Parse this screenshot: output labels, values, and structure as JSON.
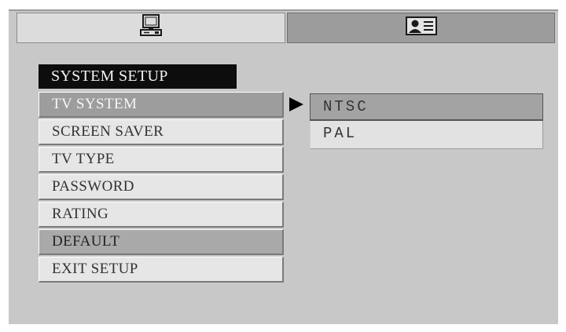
{
  "tabs": [
    {
      "icon": "monitor-icon",
      "active": true
    },
    {
      "icon": "user-profile-icon",
      "active": false
    }
  ],
  "menu": {
    "title": "SYSTEM SETUP",
    "items": [
      {
        "label": "TV SYSTEM",
        "state": "highlighted"
      },
      {
        "label": "SCREEN SAVER",
        "state": "normal"
      },
      {
        "label": "TV TYPE",
        "state": "normal"
      },
      {
        "label": "PASSWORD",
        "state": "normal"
      },
      {
        "label": "RATING",
        "state": "normal"
      },
      {
        "label": "DEFAULT",
        "state": "dark"
      },
      {
        "label": "EXIT SETUP",
        "state": "normal"
      }
    ]
  },
  "submenu": {
    "options": [
      {
        "label": "NTSC",
        "selected": true
      },
      {
        "label": "PAL",
        "selected": false
      }
    ]
  },
  "colors": {
    "panel_background": "#c8c8c8",
    "highlight": "#9d9d9d",
    "title_background": "#0d0d0d"
  }
}
